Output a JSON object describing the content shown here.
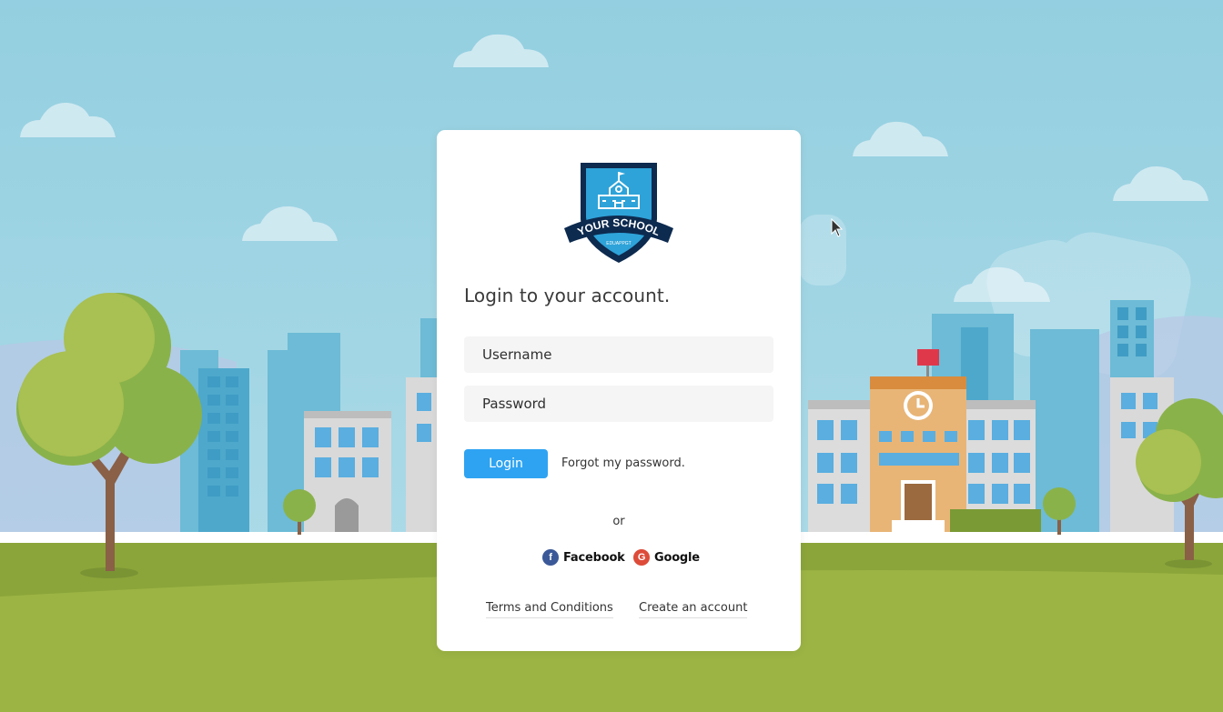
{
  "logo": {
    "name": "YOUR SCHOOL",
    "subtext": "EDUAPPGT"
  },
  "login": {
    "heading": "Login to your account.",
    "username_placeholder": "Username",
    "password_placeholder": "Password",
    "login_label": "Login",
    "forgot_label": "Forgot my password.",
    "or_label": "or"
  },
  "social": {
    "facebook_label": "Facebook",
    "facebook_icon": "facebook-icon",
    "google_label": "Google",
    "google_icon": "google-icon"
  },
  "footer": {
    "terms_label": "Terms and Conditions",
    "create_label": "Create an account"
  },
  "colors": {
    "primary": "#2ea3f2",
    "sky": "#9dd3e3",
    "grass": "#9cb444",
    "facebook": "#3b5998",
    "google": "#dd4b39"
  }
}
